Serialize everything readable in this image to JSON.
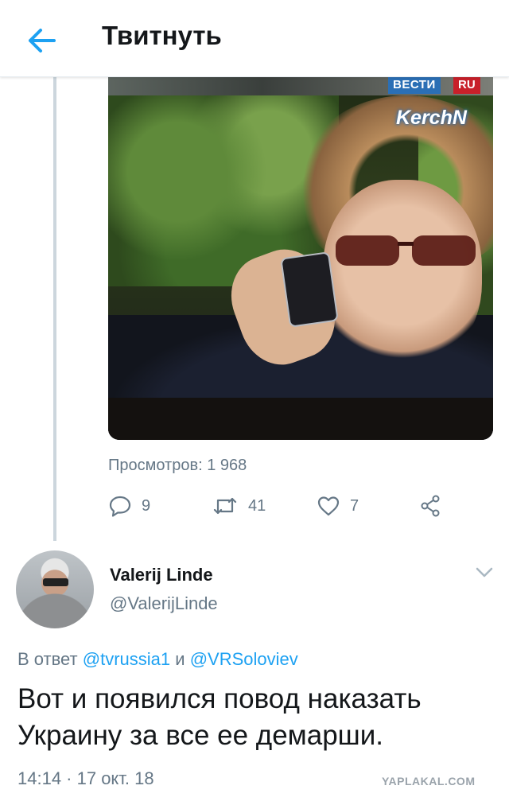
{
  "header": {
    "title": "Твитнуть",
    "back_icon": "arrow-left-icon"
  },
  "video": {
    "logo_vesti": "ВЕСТИ",
    "logo_ru": "RU",
    "logo_kerch": "KerchN"
  },
  "stats": {
    "views": "Просмотров: 1 968",
    "replies": "9",
    "retweets": "41",
    "likes": "7"
  },
  "reply_tweet": {
    "name": "Valerij Linde",
    "handle": "@ValerijLinde",
    "reply_prefix": "В ответ",
    "mention1": "@tvrussia1",
    "conj": "и",
    "mention2": "@VRSoloviev",
    "text": "Вот и появился повод наказать Украину за все ее демарши.",
    "timestamp": "14:14 · 17 окт. 18"
  },
  "watermark": "YAPLAKAL.COM",
  "colors": {
    "accent": "#1da1f2",
    "muted": "#657786",
    "text": "#14171a"
  }
}
